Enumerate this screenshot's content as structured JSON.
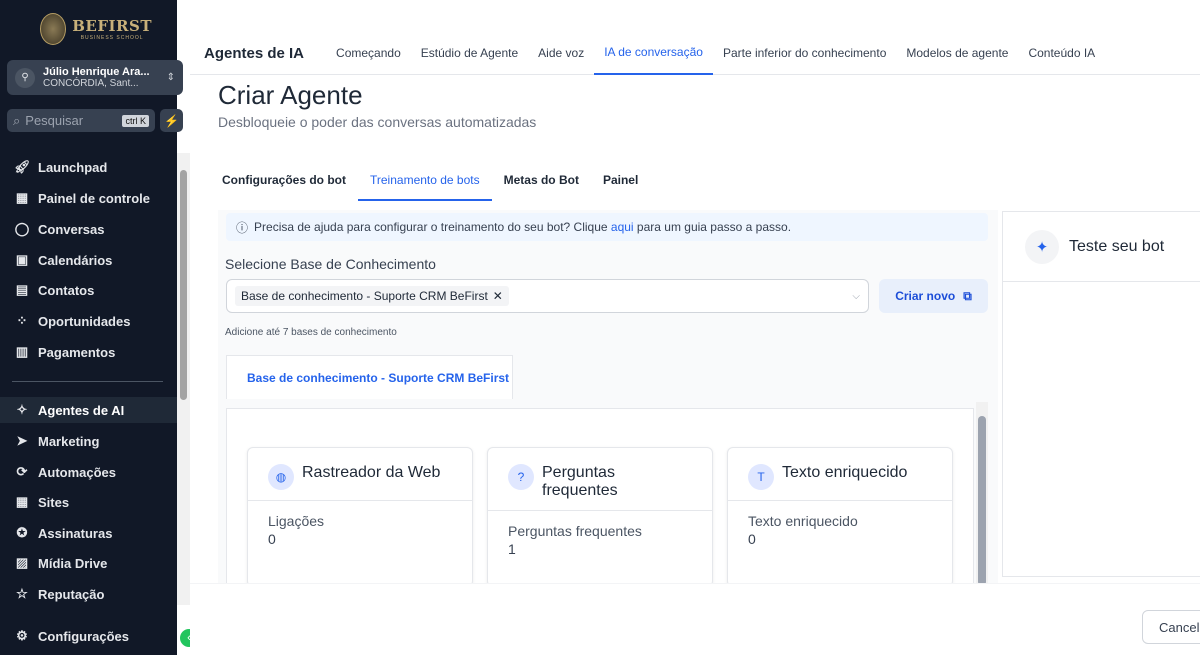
{
  "sidebar": {
    "brand": "BEFIRST",
    "brand_sub": "BUSINESS SCHOOL",
    "account_name": "Júlio Henrique Ara...",
    "account_location": "CONCÓRDIA, Sant...",
    "search_placeholder": "Pesquisar",
    "search_shortcut": "ctrl K",
    "items": [
      {
        "label": "Launchpad",
        "icon": "rocket-icon"
      },
      {
        "label": "Painel de controle",
        "icon": "grid-icon"
      },
      {
        "label": "Conversas",
        "icon": "chat-icon"
      },
      {
        "label": "Calendários",
        "icon": "calendar-icon"
      },
      {
        "label": "Contatos",
        "icon": "contacts-icon"
      },
      {
        "label": "Oportunidades",
        "icon": "opportunities-icon"
      },
      {
        "label": "Pagamentos",
        "icon": "payments-icon"
      },
      {
        "label": "Agentes de AI",
        "icon": "sparkles-icon"
      },
      {
        "label": "Marketing",
        "icon": "send-icon"
      },
      {
        "label": "Automações",
        "icon": "automation-icon"
      },
      {
        "label": "Sites",
        "icon": "sites-icon"
      },
      {
        "label": "Assinaturas",
        "icon": "award-icon"
      },
      {
        "label": "Mídia Drive",
        "icon": "image-icon"
      },
      {
        "label": "Reputação",
        "icon": "star-icon"
      }
    ],
    "settings": "Configurações"
  },
  "topnav": {
    "title": "Agentes de IA",
    "tabs": [
      "Começando",
      "Estúdio de Agente",
      "Aide voz",
      "IA de conversação",
      "Parte inferior do conhecimento",
      "Modelos de agente",
      "Conteúdo IA"
    ]
  },
  "page": {
    "title": "Criar Agente",
    "subtitle": "Desbloqueie o poder das conversas automatizadas",
    "tabs": [
      "Configurações do bot",
      "Treinamento de bots",
      "Metas do Bot",
      "Painel"
    ],
    "info_before": "Precisa de ajuda para configurar o treinamento do seu bot? Clique ",
    "info_link": "aqui",
    "info_after": " para um guia passo a passo.",
    "kb_label": "Selecione Base de Conhecimento",
    "kb_selected": "Base de conhecimento - Suporte CRM BeFirst",
    "create_new": "Criar novo",
    "hint": "Adicione até 7 bases de conhecimento",
    "kb_tab": "Base de conhecimento - Suporte CRM BeFirst",
    "cards": [
      {
        "title": "Rastreador da Web",
        "key": "Ligações",
        "value": "0"
      },
      {
        "title": "Perguntas frequentes",
        "key": "Perguntas frequentes",
        "value": "1"
      },
      {
        "title": "Texto enriquecido",
        "key": "Texto enriquecido",
        "value": "0"
      }
    ],
    "test_title": "Teste seu bot",
    "cancel": "Cancelar"
  }
}
